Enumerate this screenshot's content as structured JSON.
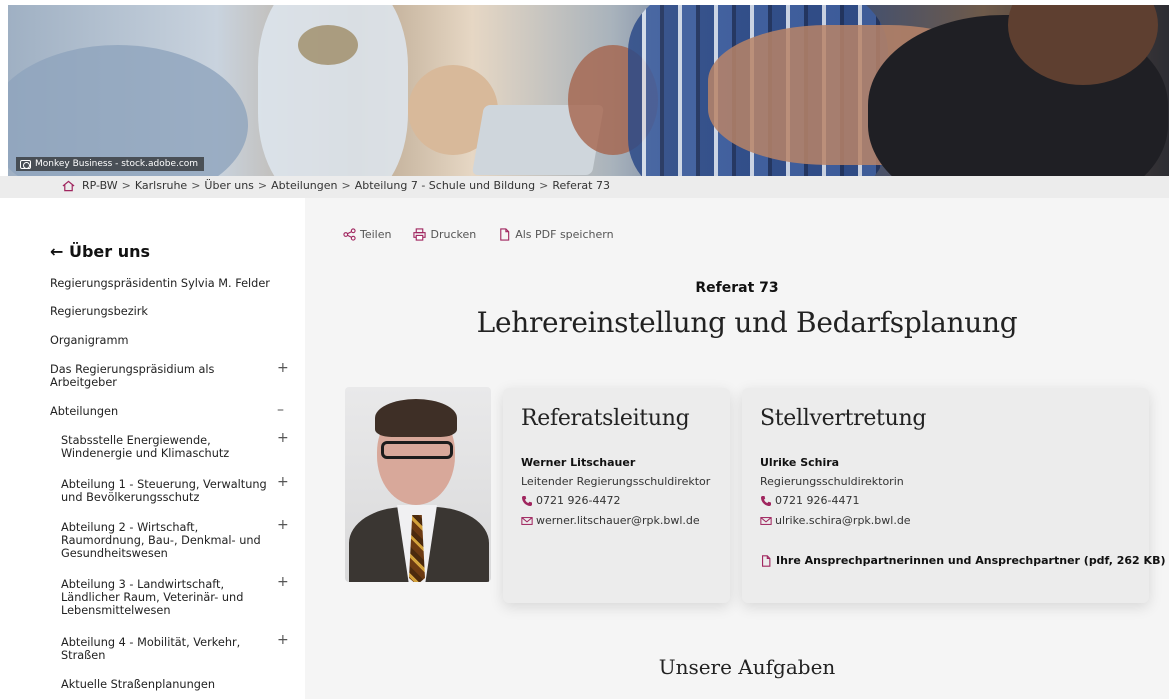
{
  "hero": {
    "credit": "Monkey Business - stock.adobe.com"
  },
  "breadcrumb": {
    "items": [
      "RP-BW",
      "Karlsruhe",
      "Über uns",
      "Abteilungen",
      "Abteilung 7 - Schule und Bildung",
      "Referat 73"
    ],
    "separator": ">"
  },
  "sidebar": {
    "title": "← Über uns",
    "items": [
      {
        "label": "Regierungspräsidentin Sylvia M. Felder",
        "toggle": ""
      },
      {
        "label": "Regierungsbezirk",
        "toggle": ""
      },
      {
        "label": "Organigramm",
        "toggle": ""
      },
      {
        "label": "Das Regierungspräsidium als Arbeitgeber",
        "toggle": "+"
      },
      {
        "label": "Abteilungen",
        "toggle": "–"
      },
      {
        "label": "Stabsstelle Energiewende, Windenergie und Klimaschutz",
        "toggle": "+"
      },
      {
        "label": "Abteilung 1 - Steuerung, Verwaltung und Bevölkerungsschutz",
        "toggle": "+"
      },
      {
        "label": "Abteilung 2 - Wirtschaft, Raumordnung, Bau-, Denkmal- und Gesundheitswesen",
        "toggle": "+"
      },
      {
        "label": "Abteilung 3 - Landwirtschaft, Ländlicher Raum, Veterinär- und Lebensmittelwesen",
        "toggle": "+"
      },
      {
        "label": "Abteilung 4 - Mobilität, Verkehr, Straßen",
        "toggle": "+"
      },
      {
        "label": "Aktuelle Straßenplanungen",
        "toggle": ""
      }
    ]
  },
  "actions": {
    "share": "Teilen",
    "print": "Drucken",
    "pdf": "Als PDF speichern"
  },
  "main": {
    "kicker": "Referat 73",
    "title": "Lehrereinstellung und Bedarfsplanung",
    "section_title": "Unsere Aufgaben"
  },
  "contacts": {
    "lead": {
      "heading": "Referatsleitung",
      "name": "Werner Litschauer",
      "role": "Leitender Regierungsschuldirektor",
      "phone": "0721 926-4472",
      "email": "werner.litschauer@rpk.bwl.de"
    },
    "deputy": {
      "heading": "Stellvertretung",
      "name": "Ulrike Schira",
      "role": "Regierungsschuldirektorin",
      "phone": "0721 926-4471",
      "email": "ulrike.schira@rpk.bwl.de",
      "document": "Ihre Ansprechpartnerinnen und Ansprechpartner (pdf, 262 KB)"
    }
  },
  "colors": {
    "accent": "#a0265f",
    "main_bg": "#f5f5f5",
    "card_bg": "#ececec",
    "breadcrumb_bg": "#ececec"
  }
}
